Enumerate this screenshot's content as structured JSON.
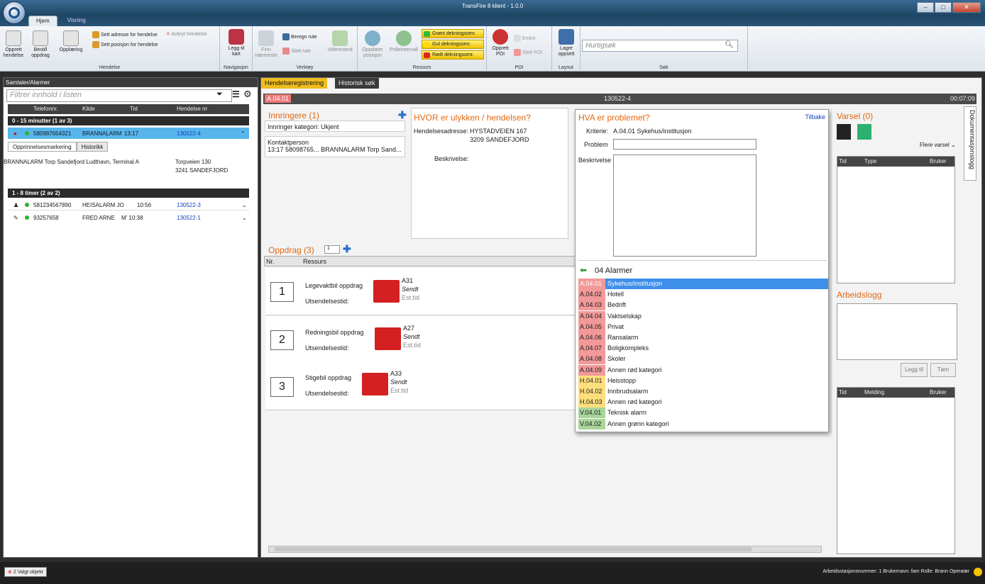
{
  "window": {
    "title": "TransFire 8 klient - 1.0.0"
  },
  "menu_tabs": [
    "Hjem",
    "Visning"
  ],
  "ribbon": {
    "hendelse": {
      "opprett": "Opprett hendelse",
      "bestill": "Bestill oppdrag",
      "opplaering": "Opplæring",
      "sett_adresse": "Sett adresse for hendelse",
      "sett_posisjon": "Sett posisjon for hendelse",
      "avbryt": "Avbryt hendelse",
      "label": "Hendelse"
    },
    "navigasjon": {
      "legg": "Legg til kart",
      "label": "Navigasjon"
    },
    "verktoy": {
      "finn": "Finn nærmeste",
      "beregn": "Beregn rute",
      "slett": "Slett rute",
      "videresend": "Videresend",
      "label": "Verktøy"
    },
    "ressurs": {
      "oppdater": "Oppdater posisjon",
      "polle": "Polleintervall",
      "gronn": "Grønt dekningsomr.",
      "gul": "Gul dekningsomr.",
      "rodt": "Rødt dekningsomr.",
      "label": "Ressurs"
    },
    "poi": {
      "opprett": "Opprett POI",
      "endre": "Endre",
      "slett": "Slett POI",
      "label": "POI"
    },
    "layout": {
      "lagre": "Lagre oppsett",
      "label": "Layout"
    },
    "sok": {
      "placeholder": "Hurtigsøk",
      "label": "Søk"
    }
  },
  "left": {
    "title": "Samtaler/Alarmer",
    "filter": "Filtrer innhold i listen",
    "cols": [
      "Telefonnr.",
      "Kilde",
      "Tid",
      "Hendelse nr"
    ],
    "group1": "0 - 15 minutter (1 av 3)",
    "row1": {
      "phone": "580987654321",
      "source": "BRANNALARM",
      "time": "13:17",
      "nr": "130522-4"
    },
    "subtabs": [
      "Opprinnelsesmarkering",
      "Historikk"
    ],
    "detail": {
      "text": "BRANNALARM Torp Sandefjord Ludthavn, Terminal A",
      "addr1": "Torpveien 130",
      "addr2": "3241 SANDEFJORD"
    },
    "group2": "1 - 8 timer (2 av 2)",
    "row2": {
      "phone": "581234567890",
      "source": "HEISALARM JO",
      "time": "10:56",
      "nr": "130522-3"
    },
    "row3": {
      "phone": "93257658",
      "source": "FRED ARNE",
      "time": "M' 10:38",
      "nr": "130522-1"
    }
  },
  "main": {
    "tabs": [
      "Hendelseregistrering",
      "Historisk søk"
    ],
    "code": "A.04.01",
    "id": "130522-4",
    "timer": "00:07:09",
    "innringere": {
      "title": "Innringere (1)",
      "kategori": "Innringer kategori: Ukjent",
      "kontakt": "Kontaktperson",
      "line": "13:17  58098765...   BRANNALARM Torp Sand..."
    },
    "hvor": {
      "title": "HVOR er ulykken / hendelsen?",
      "label": "Hendelsesadresse:",
      "addr1": "HYSTADVEIEN 167",
      "addr2": "3209 SANDEFJORD",
      "beskrivelse": "Beskrivelse:"
    },
    "oppdrag": {
      "title": "Oppdrag (3)",
      "count": "1",
      "col_nr": "Nr.",
      "col_ressurs": "Ressurs",
      "utsendelse": "Utsendelsestid:",
      "sendt": "Sendt",
      "est": "Est.tid",
      "items": [
        {
          "nr": "1",
          "type": "Legevaktbil oppdrag",
          "unit": "A31"
        },
        {
          "nr": "2",
          "type": "Redningsbil oppdrag",
          "unit": "A27"
        },
        {
          "nr": "3",
          "type": "Stigebil oppdrag",
          "unit": "A33"
        }
      ]
    }
  },
  "popup": {
    "title": "HVA er problemet?",
    "back": "Tilbake",
    "kriterie_label": "Kriterie:",
    "kriterie": "A.04.01 Sykehus/institusjon",
    "problem": "Problem",
    "beskrivelse": "Beskrivelse",
    "group": "04 Alarmer",
    "items": [
      {
        "code": "A.04.01",
        "name": "Sykehus/institusjon"
      },
      {
        "code": "A.04.02",
        "name": "Hotell"
      },
      {
        "code": "A.04.03",
        "name": "Bedrift"
      },
      {
        "code": "A.04.04",
        "name": "Vaktselskap"
      },
      {
        "code": "A.04.05",
        "name": "Privat"
      },
      {
        "code": "A.04.06",
        "name": "Ransalarm"
      },
      {
        "code": "A.04.07",
        "name": "Boligkompleks"
      },
      {
        "code": "A.04.08",
        "name": "Skoler"
      },
      {
        "code": "A.04.09",
        "name": "Annen rød kategori"
      },
      {
        "code": "H.04.01",
        "name": "Heisstopp"
      },
      {
        "code": "H.04.02",
        "name": "Innbrudsalarm"
      },
      {
        "code": "H.04.03",
        "name": "Annen rød kategori"
      },
      {
        "code": "V.04.01",
        "name": "Teknisk alarm"
      },
      {
        "code": "V.04.02",
        "name": "Annen grønn kategori"
      }
    ]
  },
  "right": {
    "varsel": "Varsel (0)",
    "flere": "Flere varsel",
    "cols1": [
      "Tid",
      "Type",
      "Bruker"
    ],
    "arbeidslogg": "Arbeidslogg",
    "legg": "Legg til",
    "tom": "Tøm",
    "cols2": [
      "Tid",
      "Melding",
      "Bruker"
    ],
    "doc": "Dokumentasjonslogg"
  },
  "status": {
    "selected": "2 Valgt objekt",
    "info": "Arbeidsstasjonsnummer: 1   Brukernavn: fam   Rolle: Brann Operatør"
  }
}
